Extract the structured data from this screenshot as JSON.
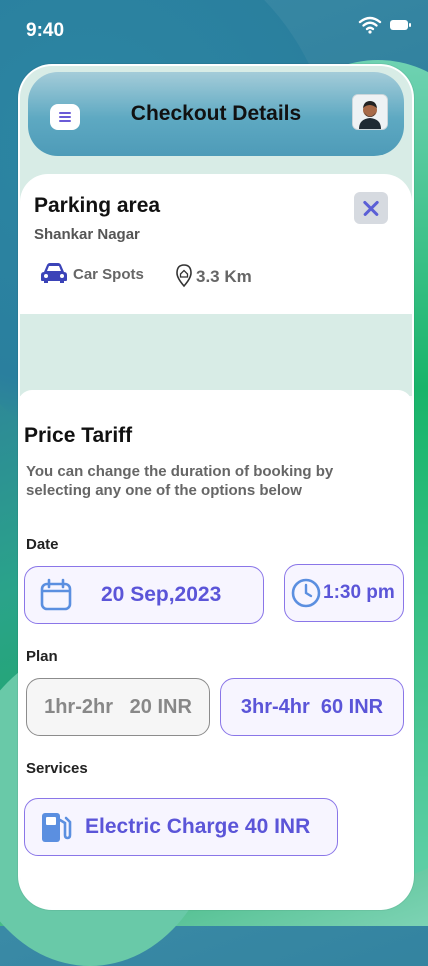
{
  "status_bar": {
    "time": "9:40"
  },
  "header": {
    "title": "Checkout Details"
  },
  "parking": {
    "title": "Parking area",
    "location": "Shankar Nagar",
    "spots_label": "Car Spots",
    "distance": "3.3 Km"
  },
  "tariff": {
    "title": "Price Tariff",
    "description": "You can change the duration of booking by selecting any one of the options below",
    "date_label": "Date",
    "date_value": "20 Sep,2023",
    "time_value": "1:30 pm",
    "plan_label": "Plan",
    "plans": [
      {
        "label": "1hr-2hr   20 INR",
        "selected": false
      },
      {
        "label": "3hr-4hr  60 INR",
        "selected": true
      }
    ],
    "services_label": "Services",
    "service": "Electric Charge 40 INR"
  },
  "colors": {
    "accent": "#5b55d8",
    "accent_border": "#8a76e8",
    "header": "#5ea9c2"
  },
  "icons": [
    "wifi-icon",
    "battery-icon",
    "menu-icon",
    "avatar",
    "close-icon",
    "car-icon",
    "location-pin-icon",
    "calendar-icon",
    "clock-icon",
    "fuel-pump-icon"
  ]
}
